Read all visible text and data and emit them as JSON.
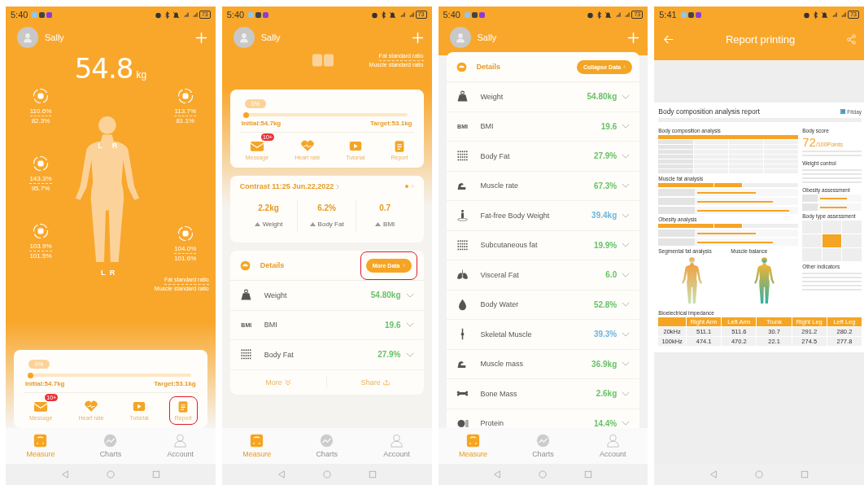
{
  "screens": [
    {
      "kind": "home",
      "status": {
        "time": "5:40",
        "battery": "73"
      },
      "user": "Sally",
      "weight": {
        "value": "54.8",
        "unit": "kg"
      },
      "left_segments": [
        {
          "fat": "110.6%",
          "muscle": "82.3%"
        },
        {
          "fat": "143.3%",
          "muscle": "95.7%"
        },
        {
          "fat": "103.9%",
          "muscle": "101.5%"
        }
      ],
      "right_segments": [
        {
          "fat": "113.7%",
          "muscle": "81.1%"
        },
        {
          "fat": "104.0%",
          "muscle": "101.6%"
        }
      ],
      "body_labels": {
        "upper": [
          "L",
          "R"
        ],
        "lower": [
          "L",
          "R"
        ]
      },
      "legend": [
        "Fat standard ratio",
        "Muscle standard ratio"
      ],
      "goal": {
        "badge": "0%",
        "level": 0,
        "initial": "Initial:54.7kg",
        "target": "Target:53.1kg"
      },
      "shortcuts": [
        {
          "label": "Message",
          "badge": "10+",
          "highlighted": false
        },
        {
          "label": "Heart rate",
          "highlighted": false
        },
        {
          "label": "Tutorial",
          "highlighted": false
        },
        {
          "label": "Report",
          "highlighted": true
        }
      ],
      "tabs": [
        {
          "label": "Measure",
          "selected": true
        },
        {
          "label": "Charts",
          "selected": false
        },
        {
          "label": "Account",
          "selected": false
        }
      ]
    },
    {
      "kind": "summary",
      "status": {
        "time": "5:40",
        "battery": "73"
      },
      "user": "Sally",
      "legend": [
        "Fat standard ratio",
        "Muscle standard ratio"
      ],
      "goal": {
        "badge": "0%",
        "level": 0,
        "initial": "Initial:54.7kg",
        "target": "Target:53.1kg"
      },
      "shortcuts": [
        {
          "label": "Message",
          "badge": "10+",
          "highlighted": false
        },
        {
          "label": "Heart rate",
          "highlighted": false
        },
        {
          "label": "Tutorial",
          "highlighted": false
        },
        {
          "label": "Report",
          "highlighted": false
        }
      ],
      "contrast": {
        "title": "Contrast 11:25 Jun.22,2022",
        "pager": [
          {
            "selected": true
          },
          {
            "selected": false
          }
        ],
        "stats": [
          {
            "value": "2.2kg",
            "label": "Weight"
          },
          {
            "value": "6.2%",
            "label": "Body Fat"
          },
          {
            "value": "0.7",
            "label": "BMI"
          }
        ]
      },
      "details": {
        "title": "Details",
        "button": {
          "label": "More Data",
          "highlighted": true
        },
        "rows": [
          {
            "name": "Weight",
            "value": "54.80kg",
            "color": "#66c266"
          },
          {
            "name": "BMI",
            "icon_text": "BMI",
            "value": "19.6",
            "color": "#66c266"
          },
          {
            "name": "Body Fat",
            "value": "27.9%",
            "color": "#66c266"
          }
        ],
        "footer": {
          "more": "More",
          "share": "Share"
        }
      },
      "tabs": [
        {
          "label": "Measure",
          "selected": true
        },
        {
          "label": "Charts",
          "selected": false
        },
        {
          "label": "Account",
          "selected": false
        }
      ]
    },
    {
      "kind": "details",
      "status": {
        "time": "5:40",
        "battery": "73"
      },
      "user": "Sally",
      "details": {
        "title": "Details",
        "button": {
          "label": "Collapse Data",
          "highlighted": false
        },
        "rows": [
          {
            "name": "Weight",
            "value": "54.80kg",
            "color": "#66c266"
          },
          {
            "name": "BMI",
            "icon_text": "BMI",
            "value": "19.6",
            "color": "#66c266"
          },
          {
            "name": "Body Fat",
            "value": "27.9%",
            "color": "#66c266"
          },
          {
            "name": "Muscle rate",
            "value": "67.3%",
            "color": "#66c266"
          },
          {
            "name": "Fat-free Body Weight",
            "value": "39.4kg",
            "color": "#6cb6e0"
          },
          {
            "name": "Subcutaneous fat",
            "value": "19.9%",
            "color": "#66c266"
          },
          {
            "name": "Visceral Fat",
            "value": "6.0",
            "color": "#66c266"
          },
          {
            "name": "Body Water",
            "value": "52.8%",
            "color": "#66c266"
          },
          {
            "name": "Skeletal Muscle",
            "value": "39.3%",
            "color": "#6cb6e0"
          },
          {
            "name": "Muscle mass",
            "value": "36.9kg",
            "color": "#66c266"
          },
          {
            "name": "Bone Mass",
            "value": "2.6kg",
            "color": "#66c266"
          },
          {
            "name": "Protein",
            "value": "14.4%",
            "color": "#66c266"
          }
        ]
      },
      "tabs": [
        {
          "label": "Measure",
          "selected": true
        },
        {
          "label": "Charts",
          "selected": false
        },
        {
          "label": "Account",
          "selected": false
        }
      ]
    },
    {
      "kind": "report",
      "status": {
        "time": "5:41",
        "battery": "73"
      },
      "title": "Report printing",
      "report": {
        "title": "Body composition analysis report",
        "brand": "Fitday",
        "left_sections": [
          {
            "kind": "table",
            "heading": "Body composition analysis"
          },
          {
            "kind": "bars",
            "heading": "Muscle fat analysis"
          },
          {
            "kind": "bars",
            "heading": "Obesity analysis"
          }
        ],
        "figures": [
          {
            "heading": "Segmental fat analysis"
          },
          {
            "heading": "Muscle balance"
          }
        ],
        "impedance": {
          "heading": "Bioelectrical impedance",
          "columns": [
            "Right Arm",
            "Left Arm",
            "Trunk",
            "Right Leg",
            "Left Leg"
          ],
          "rows": [
            {
              "label": "20kHz",
              "values": [
                "511.1",
                "511.6",
                "30.7",
                "291.2",
                "280.2"
              ]
            },
            {
              "label": "100kHz",
              "values": [
                "474.1",
                "470.2",
                "22.1",
                "274.5",
                "277.8"
              ]
            }
          ]
        },
        "score": {
          "heading": "Body score",
          "value": "72",
          "suffix": "/100Points"
        },
        "right_sections": [
          {
            "kind": "lines",
            "heading": "Weight control"
          },
          {
            "kind": "bars",
            "heading": "Obesity assessment"
          },
          {
            "kind": "grid",
            "heading": "Body type assessment"
          },
          {
            "kind": "lines",
            "heading": "Other indicators"
          }
        ]
      }
    }
  ]
}
